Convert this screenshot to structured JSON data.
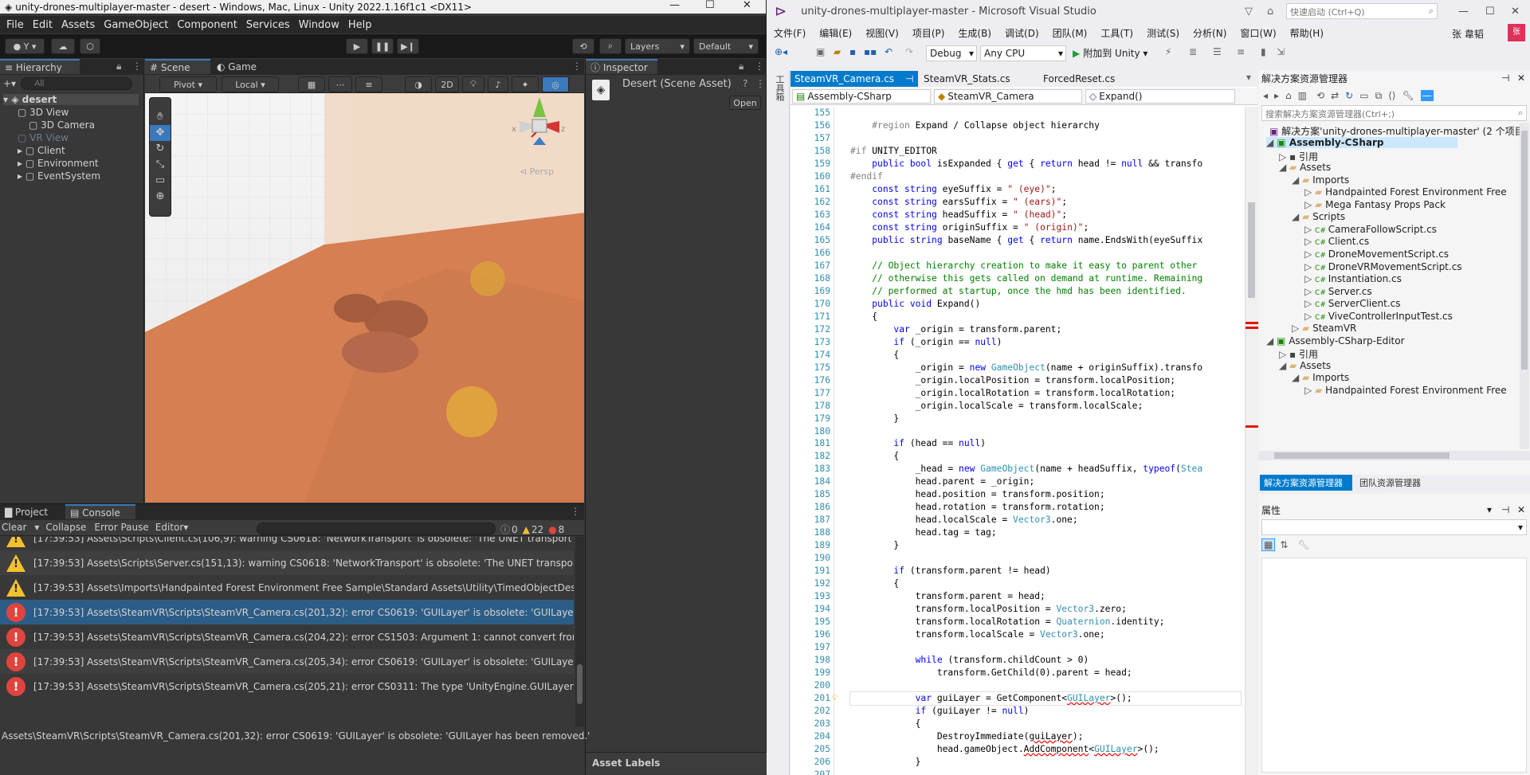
{
  "unity": {
    "title": "unity-drones-multiplayer-master - desert - Windows, Mac, Linux - Unity 2022.1.16f1c1 <DX11>",
    "menu": [
      "File",
      "Edit",
      "Assets",
      "GameObject",
      "Component",
      "Services",
      "Window",
      "Help"
    ],
    "toolbar": {
      "account": "Y",
      "layers": "Layers",
      "layout": "Default"
    },
    "hierarchy": {
      "tab": "Hierarchy",
      "search_placeholder": "All",
      "items": [
        {
          "label": "desert",
          "indent": 0
        },
        {
          "label": "3D View",
          "indent": 1
        },
        {
          "label": "3D Camera",
          "indent": 2
        },
        {
          "label": "VR View",
          "indent": 1
        },
        {
          "label": "Client",
          "indent": 1
        },
        {
          "label": "Environment",
          "indent": 1
        },
        {
          "label": "EventSystem",
          "indent": 1
        }
      ]
    },
    "scene": {
      "tabs": [
        "Scene",
        "Game"
      ],
      "pivot": "Pivot",
      "local": "Local",
      "mode2d": "2D",
      "persp": "Persp",
      "axis_x": "x",
      "axis_z": "z"
    },
    "inspector": {
      "tab": "Inspector",
      "asset": "Desert (Scene Asset)",
      "open": "Open",
      "asset_labels": "Asset Labels"
    },
    "console": {
      "tabs": [
        "Project",
        "Console"
      ],
      "clear": "Clear",
      "collapse": "Collapse",
      "error_pause": "Error Pause",
      "editor": "Editor",
      "count_info": "0",
      "count_warn": "22",
      "count_err": "8",
      "rows": [
        {
          "type": "warn",
          "text": "[17:39:53] Assets\\Scripts\\Client.cs(106,9): warning CS0618: 'NetworkTransport' is obsolete: 'The UNET transport will be"
        },
        {
          "type": "warn",
          "text": "[17:39:53] Assets\\Scripts\\Server.cs(151,13): warning CS0618: 'NetworkTransport' is obsolete: 'The UNET transport will be"
        },
        {
          "type": "warn",
          "text": "[17:39:53] Assets\\Imports\\Handpainted Forest Environment Free Sample\\Standard Assets\\Utility\\TimedObjectDestructor.c"
        },
        {
          "type": "err",
          "text": "[17:39:53] Assets\\SteamVR\\Scripts\\SteamVR_Camera.cs(201,32): error CS0619: 'GUILayer' is obsolete: 'GUILayer has bee"
        },
        {
          "type": "err",
          "text": "[17:39:53] Assets\\SteamVR\\Scripts\\SteamVR_Camera.cs(204,22): error CS1503: Argument 1: cannot convert from 'UnityEr"
        },
        {
          "type": "err",
          "text": "[17:39:53] Assets\\SteamVR\\Scripts\\SteamVR_Camera.cs(205,34): error CS0619: 'GUILayer' is obsolete: 'GUILayer has be"
        },
        {
          "type": "err",
          "text": "[17:39:53] Assets\\SteamVR\\Scripts\\SteamVR_Camera.cs(205,21): error CS0311: The type 'UnityEngine.GUILayer' cannot b"
        }
      ],
      "status": "Assets\\SteamVR\\Scripts\\SteamVR_Camera.cs(201,32): error CS0619: 'GUILayer' is obsolete: 'GUILayer has been removed.'"
    }
  },
  "vs": {
    "title": "unity-drones-multiplayer-master - Microsoft Visual Studio",
    "quick_launch": "快速启动 (Ctrl+Q)",
    "menu": [
      "文件(F)",
      "编辑(E)",
      "视图(V)",
      "项目(P)",
      "生成(B)",
      "调试(D)",
      "团队(M)",
      "工具(T)",
      "测试(S)",
      "分析(N)",
      "窗口(W)",
      "帮助(H)"
    ],
    "user": "张 韋韬",
    "toolbar": {
      "config": "Debug",
      "platform": "Any CPU",
      "attach": "附加到 Unity"
    },
    "tabs": [
      "SteamVR_Camera.cs",
      "SteamVR_Stats.cs",
      "ForcedReset.cs"
    ],
    "nav": [
      "Assembly-CSharp",
      "SteamVR_Camera",
      "Expand()"
    ],
    "side_label": "工具箱",
    "solution": {
      "title": "解决方案资源管理器",
      "search": "搜索解决方案资源管理器(Ctrl+;)",
      "root": "解决方案'unity-drones-multiplayer-master' (2 个项目",
      "items": [
        {
          "label": "Assembly-CSharp",
          "indent": 0,
          "kind": "project",
          "bold": true
        },
        {
          "label": "引用",
          "indent": 1,
          "kind": "ref"
        },
        {
          "label": "Assets",
          "indent": 1,
          "kind": "folder"
        },
        {
          "label": "Imports",
          "indent": 2,
          "kind": "folder"
        },
        {
          "label": "Handpainted Forest Environment Free",
          "indent": 3,
          "kind": "folder"
        },
        {
          "label": "Mega Fantasy Props Pack",
          "indent": 3,
          "kind": "folder"
        },
        {
          "label": "Scripts",
          "indent": 2,
          "kind": "folder"
        },
        {
          "label": "CameraFollowScript.cs",
          "indent": 3,
          "kind": "cs"
        },
        {
          "label": "Client.cs",
          "indent": 3,
          "kind": "cs"
        },
        {
          "label": "DroneMovementScript.cs",
          "indent": 3,
          "kind": "cs"
        },
        {
          "label": "DroneVRMovementScript.cs",
          "indent": 3,
          "kind": "cs"
        },
        {
          "label": "Instantiation.cs",
          "indent": 3,
          "kind": "cs"
        },
        {
          "label": "Server.cs",
          "indent": 3,
          "kind": "cs"
        },
        {
          "label": "ServerClient.cs",
          "indent": 3,
          "kind": "cs"
        },
        {
          "label": "ViveControllerInputTest.cs",
          "indent": 3,
          "kind": "cs"
        },
        {
          "label": "SteamVR",
          "indent": 2,
          "kind": "folder"
        },
        {
          "label": "Assembly-CSharp-Editor",
          "indent": 0,
          "kind": "project"
        },
        {
          "label": "引用",
          "indent": 1,
          "kind": "ref"
        },
        {
          "label": "Assets",
          "indent": 1,
          "kind": "folder"
        },
        {
          "label": "Imports",
          "indent": 2,
          "kind": "folder"
        },
        {
          "label": "Handpainted Forest Environment Free",
          "indent": 3,
          "kind": "folder"
        }
      ],
      "tabs": [
        "解决方案资源管理器",
        "团队资源管理器"
      ]
    },
    "properties": {
      "title": "属性"
    },
    "code": [
      {
        "n": "155",
        "t": ""
      },
      {
        "n": "156",
        "t": "    <span class=\"pp\">#region</span> Expand / Collapse object hierarchy"
      },
      {
        "n": "157",
        "t": ""
      },
      {
        "n": "158",
        "t": "<span class=\"pp\">#if</span> UNITY_EDITOR"
      },
      {
        "n": "159",
        "t": "    <span class=\"kw\">public bool</span> isExpanded { <span class=\"kw\">get</span> { <span class=\"kw\">return</span> head != <span class=\"kw\">null</span> &amp;&amp; transfo"
      },
      {
        "n": "160",
        "t": "<span class=\"pp\">#endif</span>"
      },
      {
        "n": "161",
        "t": "    <span class=\"kw\">const string</span> eyeSuffix = <span class=\"st\">\" (eye)\"</span>;"
      },
      {
        "n": "162",
        "t": "    <span class=\"kw\">const string</span> earsSuffix = <span class=\"st\">\" (ears)\"</span>;"
      },
      {
        "n": "163",
        "t": "    <span class=\"kw\">const string</span> headSuffix = <span class=\"st\">\" (head)\"</span>;"
      },
      {
        "n": "164",
        "t": "    <span class=\"kw\">const string</span> originSuffix = <span class=\"st\">\" (origin)\"</span>;"
      },
      {
        "n": "165",
        "t": "    <span class=\"kw\">public string</span> baseName { <span class=\"kw\">get</span> { <span class=\"kw\">return</span> name.EndsWith(eyeSuffix"
      },
      {
        "n": "166",
        "t": ""
      },
      {
        "n": "167",
        "t": "    <span class=\"cm\">// Object hierarchy creation to make it easy to parent other</span>"
      },
      {
        "n": "168",
        "t": "    <span class=\"cm\">// otherwise this gets called on demand at runtime. Remaining</span>"
      },
      {
        "n": "169",
        "t": "    <span class=\"cm\">// performed at startup, once the hmd has been identified.</span>"
      },
      {
        "n": "170",
        "t": "    <span class=\"kw\">public void</span> Expand()"
      },
      {
        "n": "171",
        "t": "    {"
      },
      {
        "n": "172",
        "t": "        <span class=\"kw\">var</span> _origin = transform.parent;"
      },
      {
        "n": "173",
        "t": "        <span class=\"kw\">if</span> (_origin == <span class=\"kw\">null</span>)"
      },
      {
        "n": "174",
        "t": "        {"
      },
      {
        "n": "175",
        "t": "            _origin = <span class=\"kw\">new</span> <span class=\"ty\">GameObject</span>(name + originSuffix).transfo"
      },
      {
        "n": "176",
        "t": "            _origin.localPosition = transform.localPosition;"
      },
      {
        "n": "177",
        "t": "            _origin.localRotation = transform.localRotation;"
      },
      {
        "n": "178",
        "t": "            _origin.localScale = transform.localScale;"
      },
      {
        "n": "179",
        "t": "        }"
      },
      {
        "n": "180",
        "t": ""
      },
      {
        "n": "181",
        "t": "        <span class=\"kw\">if</span> (head == <span class=\"kw\">null</span>)"
      },
      {
        "n": "182",
        "t": "        {"
      },
      {
        "n": "183",
        "t": "            _head = <span class=\"kw\">new</span> <span class=\"ty\">GameObject</span>(name + headSuffix, <span class=\"kw\">typeof</span>(<span class=\"ty\">Stea</span>"
      },
      {
        "n": "184",
        "t": "            head.parent = _origin;"
      },
      {
        "n": "185",
        "t": "            head.position = transform.position;"
      },
      {
        "n": "186",
        "t": "            head.rotation = transform.rotation;"
      },
      {
        "n": "187",
        "t": "            head.localScale = <span class=\"ty\">Vector3</span>.one;"
      },
      {
        "n": "188",
        "t": "            head.tag = tag;"
      },
      {
        "n": "189",
        "t": "        }"
      },
      {
        "n": "190",
        "t": ""
      },
      {
        "n": "191",
        "t": "        <span class=\"kw\">if</span> (transform.parent != head)"
      },
      {
        "n": "192",
        "t": "        {"
      },
      {
        "n": "193",
        "t": "            transform.parent = head;"
      },
      {
        "n": "194",
        "t": "            transform.localPosition = <span class=\"ty\">Vector3</span>.zero;"
      },
      {
        "n": "195",
        "t": "            transform.localRotation = <span class=\"ty\">Quaternion</span>.identity;"
      },
      {
        "n": "196",
        "t": "            transform.localScale = <span class=\"ty\">Vector3</span>.one;"
      },
      {
        "n": "197",
        "t": ""
      },
      {
        "n": "198",
        "t": "            <span class=\"kw\">while</span> (transform.childCount &gt; 0)"
      },
      {
        "n": "199",
        "t": "                transform.GetChild(0).parent = head;"
      },
      {
        "n": "200",
        "t": ""
      },
      {
        "n": "201",
        "t": "            <span class=\"kw\">var</span> guiLayer = GetComponent&lt;<span class=\"ty\" style=\"text-decoration:underline wavy red\">GUILayer</span>&gt;();"
      },
      {
        "n": "202",
        "t": "            <span class=\"kw\">if</span> (guiLayer != <span class=\"kw\">null</span>)"
      },
      {
        "n": "203",
        "t": "            {"
      },
      {
        "n": "204",
        "t": "                DestroyImmediate(<span style=\"text-decoration:underline wavy red\">guiLayer</span>);"
      },
      {
        "n": "205",
        "t": "                head.gameObject.<span style=\"text-decoration:underline wavy red\">AddComponent</span>&lt;<span class=\"ty\" style=\"text-decoration:underline wavy red\">GUILayer</span>&gt;();"
      },
      {
        "n": "206",
        "t": "            }"
      },
      {
        "n": "207",
        "t": ""
      }
    ]
  }
}
